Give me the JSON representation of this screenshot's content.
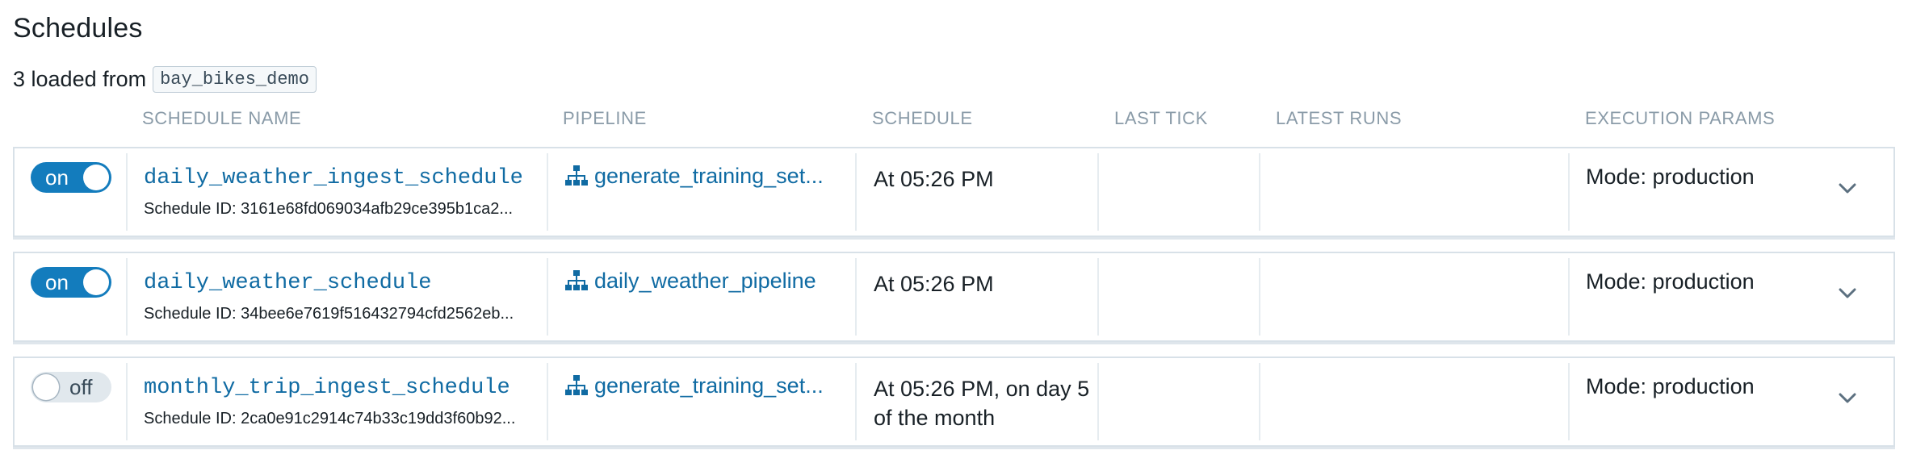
{
  "page": {
    "title": "Schedules",
    "loaded_text": "3 loaded from",
    "repository": "bay_bikes_demo"
  },
  "columns": {
    "schedule_name": "Schedule Name",
    "pipeline": "Pipeline",
    "schedule": "Schedule",
    "last_tick": "Last Tick",
    "latest_runs": "Latest Runs",
    "execution_params": "Execution Params"
  },
  "rows": [
    {
      "toggle": "on",
      "name": "daily_weather_ingest_schedule",
      "schedule_id": "Schedule ID: 3161e68fd069034afb29ce395b1ca2...",
      "pipeline_icon": "pipeline-icon",
      "pipeline": "generate_training_set...",
      "schedule": "At 05:26 PM",
      "last_tick": "",
      "latest_runs": "",
      "execution_params": "Mode: production"
    },
    {
      "toggle": "on",
      "name": "daily_weather_schedule",
      "schedule_id": "Schedule ID: 34bee6e7619f516432794cfd2562eb...",
      "pipeline_icon": "pipeline-icon",
      "pipeline": "daily_weather_pipeline",
      "schedule": "At 05:26 PM",
      "last_tick": "",
      "latest_runs": "",
      "execution_params": "Mode: production"
    },
    {
      "toggle": "off",
      "name": "monthly_trip_ingest_schedule",
      "schedule_id": "Schedule ID: 2ca0e91c2914c74b33c19dd3f60b92...",
      "pipeline_icon": "pipeline-icon",
      "pipeline": "generate_training_set...",
      "schedule": "At 05:26 PM, on day 5 of the month",
      "last_tick": "",
      "latest_runs": "",
      "execution_params": "Mode: production"
    }
  ],
  "colors": {
    "accent": "#137cbd",
    "link": "#106ba3",
    "header_text": "#8a9ba8",
    "row_border": "#d8e1e8"
  }
}
